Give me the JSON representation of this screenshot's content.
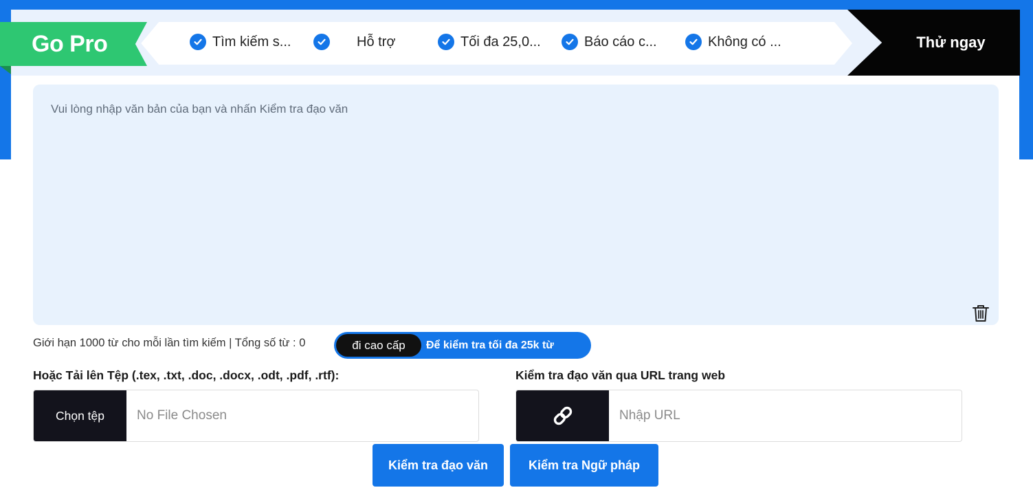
{
  "promo": {
    "badge": "Go Pro",
    "features": [
      "Tìm kiếm s...",
      "Hỗ trợ",
      "Tối đa 25,0...",
      "Báo cáo c...",
      "Không có ..."
    ],
    "cta": "Thử ngay"
  },
  "editor": {
    "placeholder": "Vui lòng nhập văn bản của bạn và nhấn Kiểm tra đạo văn"
  },
  "limit": {
    "text": "Giới hạn 1000 từ cho mỗi lần tìm kiếm | Tổng số từ : 0",
    "upgrade_label": "đi cao cấp",
    "upgrade_text": "Để kiểm tra tối đa 25k từ"
  },
  "upload": {
    "label": "Hoặc Tải lên Tệp (.tex, .txt, .doc, .docx, .odt, .pdf, .rtf):",
    "button": "Chọn tệp",
    "status": "No File Chosen"
  },
  "url": {
    "label": "Kiểm tra đạo văn qua URL trang web",
    "placeholder": "Nhập URL"
  },
  "actions": {
    "plagiarism": "Kiểm tra đạo văn",
    "grammar": "Kiểm tra Ngữ pháp"
  },
  "colors": {
    "primary": "#1476e8",
    "green": "#2ec772",
    "dark": "#13131c",
    "editor_bg": "#e8f2fd"
  }
}
